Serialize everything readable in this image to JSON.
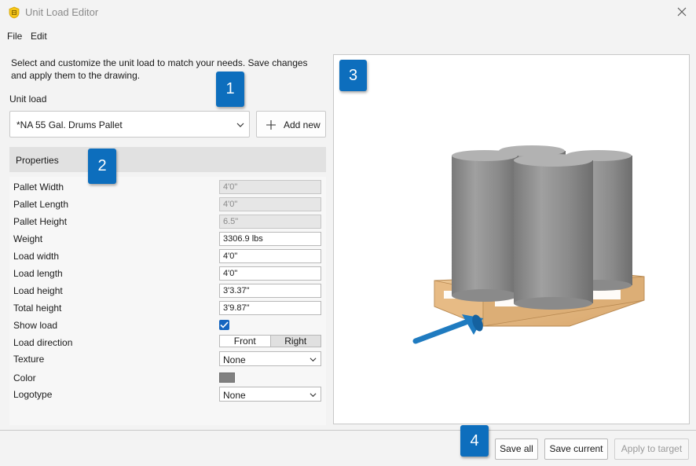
{
  "window": {
    "title": "Unit Load Editor"
  },
  "menu": {
    "file": "File",
    "edit": "Edit"
  },
  "intro_text": "Select and customize the unit load to match your needs. Save changes and apply them to the drawing.",
  "unit_load": {
    "label": "Unit load",
    "selected": "*NA 55 Gal. Drums Pallet",
    "add_new_label": "Add new"
  },
  "properties": {
    "header": "Properties",
    "rows": [
      {
        "label": "Pallet Width",
        "value": "4'0\"",
        "disabled": true
      },
      {
        "label": "Pallet Length",
        "value": "4'0\"",
        "disabled": true
      },
      {
        "label": "Pallet Height",
        "value": "6.5\"",
        "disabled": true
      },
      {
        "label": "Weight",
        "value": "3306.9 lbs",
        "disabled": false
      },
      {
        "label": "Load width",
        "value": "4'0\"",
        "disabled": false
      },
      {
        "label": "Load length",
        "value": "4'0\"",
        "disabled": false
      },
      {
        "label": "Load height",
        "value": "3'3.37\"",
        "disabled": false
      },
      {
        "label": "Total height",
        "value": "3'9.87\"",
        "disabled": false
      }
    ],
    "show_load": {
      "label": "Show load",
      "checked": true
    },
    "load_direction": {
      "label": "Load direction",
      "options": [
        "Front",
        "Right"
      ],
      "selected": "Right"
    },
    "texture": {
      "label": "Texture",
      "value": "None"
    },
    "color": {
      "label": "Color",
      "value": "#808080"
    },
    "logotype": {
      "label": "Logotype",
      "value": "None"
    }
  },
  "footer": {
    "save_all": "Save all",
    "save_current": "Save current",
    "apply_to_target": "Apply to target"
  },
  "badges": [
    "1",
    "2",
    "3",
    "4"
  ],
  "colors": {
    "badge": "#0d6ebd",
    "checkbox": "#1565c0",
    "drum": "#8c8c8c",
    "pallet": "#e2b583",
    "arrow": "#1f7bc0"
  },
  "icons": {
    "app": "shield-badge-icon",
    "close": "close-icon",
    "combo": "chevron-down-icon",
    "add": "plus-icon"
  }
}
